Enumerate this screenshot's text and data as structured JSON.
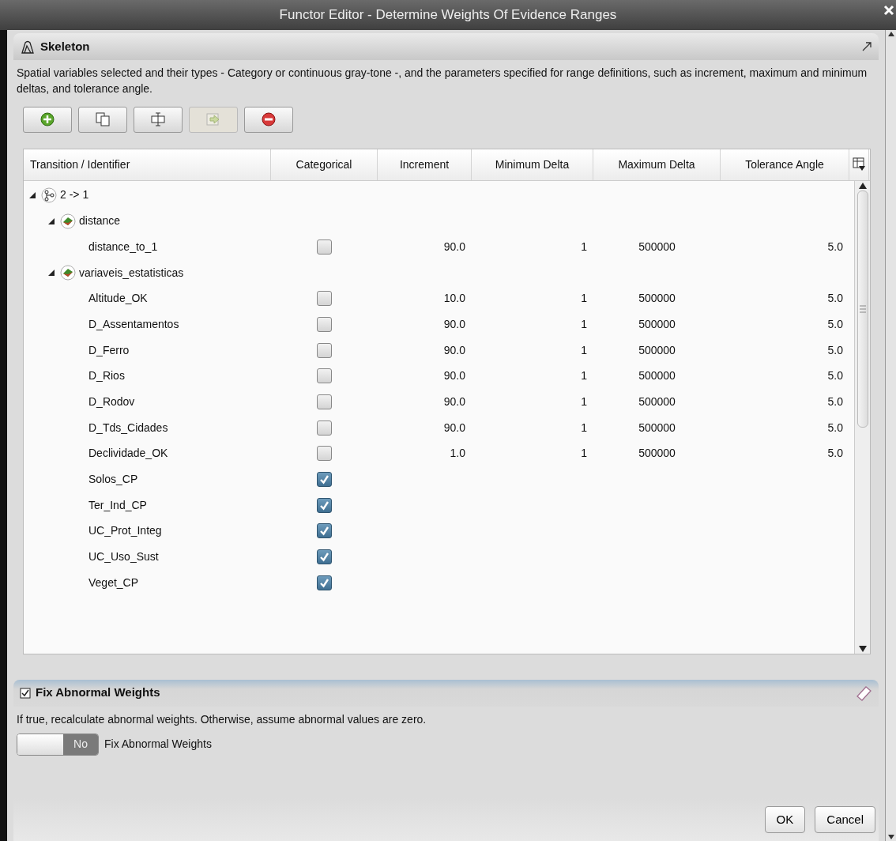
{
  "window": {
    "title": "Functor Editor - Determine Weights Of Evidence Ranges"
  },
  "skeleton": {
    "title": "Skeleton",
    "description": "Spatial variables selected and their types - Category or continuous gray-tone -, and the parameters specified for range definitions, such as increment, maximum and minimum deltas, and tolerance angle.",
    "toolbar": [
      {
        "kind": "add",
        "disabled": false
      },
      {
        "kind": "copy",
        "disabled": false
      },
      {
        "kind": "edit",
        "disabled": false
      },
      {
        "kind": "export",
        "disabled": true
      },
      {
        "kind": "remove",
        "disabled": false
      }
    ]
  },
  "table": {
    "columns": [
      "Transition / Identifier",
      "Categorical",
      "Increment",
      "Minimum Delta",
      "Maximum Delta",
      "Tolerance Angle"
    ],
    "rows": [
      {
        "label": "2 -> 1",
        "kind": "transition",
        "expanded": true,
        "children": [
          {
            "label": "distance",
            "kind": "map",
            "expanded": true,
            "children": [
              {
                "label": "distance_to_1",
                "kind": "variable",
                "categorical": false,
                "increment": "90.0",
                "minimum_delta": "1",
                "maximum_delta": "500000",
                "tolerance_angle": "5.0"
              }
            ]
          },
          {
            "label": "variaveis_estatisticas",
            "kind": "map",
            "expanded": true,
            "children": [
              {
                "label": "Altitude_OK",
                "kind": "variable",
                "categorical": false,
                "increment": "10.0",
                "minimum_delta": "1",
                "maximum_delta": "500000",
                "tolerance_angle": "5.0"
              },
              {
                "label": "D_Assentamentos",
                "kind": "variable",
                "categorical": false,
                "increment": "90.0",
                "minimum_delta": "1",
                "maximum_delta": "500000",
                "tolerance_angle": "5.0"
              },
              {
                "label": "D_Ferro",
                "kind": "variable",
                "categorical": false,
                "increment": "90.0",
                "minimum_delta": "1",
                "maximum_delta": "500000",
                "tolerance_angle": "5.0"
              },
              {
                "label": "D_Rios",
                "kind": "variable",
                "categorical": false,
                "increment": "90.0",
                "minimum_delta": "1",
                "maximum_delta": "500000",
                "tolerance_angle": "5.0"
              },
              {
                "label": "D_Rodov",
                "kind": "variable",
                "categorical": false,
                "increment": "90.0",
                "minimum_delta": "1",
                "maximum_delta": "500000",
                "tolerance_angle": "5.0"
              },
              {
                "label": "D_Tds_Cidades",
                "kind": "variable",
                "categorical": false,
                "increment": "90.0",
                "minimum_delta": "1",
                "maximum_delta": "500000",
                "tolerance_angle": "5.0"
              },
              {
                "label": "Declividade_OK",
                "kind": "variable",
                "categorical": false,
                "increment": "1.0",
                "minimum_delta": "1",
                "maximum_delta": "500000",
                "tolerance_angle": "5.0"
              },
              {
                "label": "Solos_CP",
                "kind": "variable",
                "categorical": true
              },
              {
                "label": "Ter_Ind_CP",
                "kind": "variable",
                "categorical": true
              },
              {
                "label": "UC_Prot_Integ",
                "kind": "variable",
                "categorical": true
              },
              {
                "label": "UC_Uso_Sust",
                "kind": "variable",
                "categorical": true
              },
              {
                "label": "Veget_CP",
                "kind": "variable",
                "categorical": true
              }
            ]
          }
        ]
      }
    ]
  },
  "fix_abnormal": {
    "title": "Fix Abnormal Weights",
    "description": "If true, recalculate abnormal weights. Otherwise, assume abnormal values are zero.",
    "toggle": {
      "on": false,
      "state_label": "No",
      "label": "Fix Abnormal Weights"
    }
  },
  "buttons": [
    {
      "label": "OK"
    },
    {
      "label": "Cancel"
    }
  ]
}
